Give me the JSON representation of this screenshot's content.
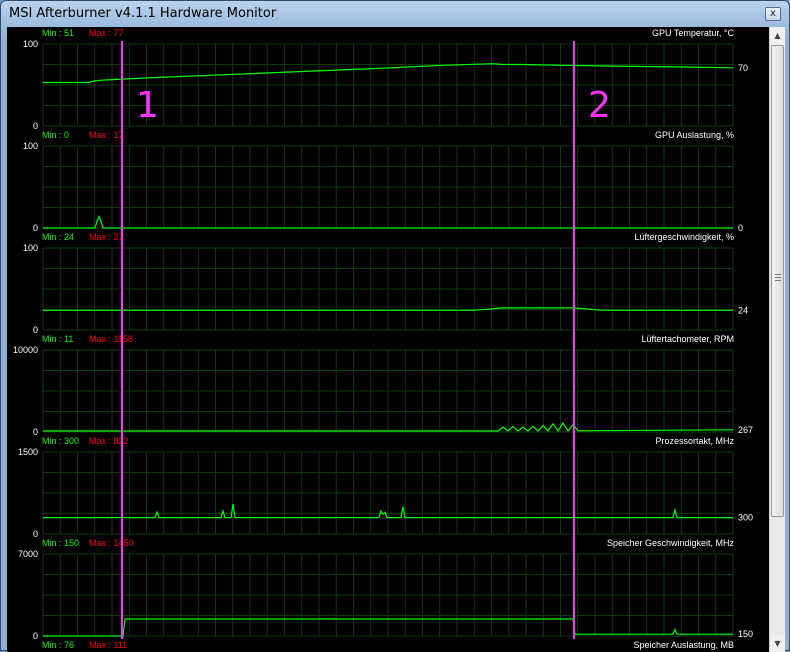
{
  "window": {
    "title": "MSI Afterburner v4.1.1 Hardware Monitor",
    "close_label": "x"
  },
  "scrollbar": {
    "up_arrow": "▲",
    "down_arrow": "▼"
  },
  "colors": {
    "graph_line": "#00ff00",
    "grid": "#0c3a0c",
    "marker": "#ff30ff",
    "min_text": "#00ff00",
    "max_text": "#ff0000"
  },
  "markers": [
    {
      "label": "1"
    },
    {
      "label": "2"
    }
  ],
  "graphs": [
    {
      "id": "gpu-temp",
      "title": "GPU Temperatur, °C",
      "min_label": "Min : 51",
      "max_label": "Max : 77",
      "y_top": "100",
      "y_bottom": "0",
      "current": "70",
      "ymax": 100,
      "series": [
        [
          0,
          53
        ],
        [
          45,
          53
        ],
        [
          52,
          55
        ],
        [
          60,
          56
        ],
        [
          110,
          59
        ],
        [
          170,
          62
        ],
        [
          250,
          66
        ],
        [
          330,
          70
        ],
        [
          400,
          74
        ],
        [
          450,
          76
        ],
        [
          460,
          75
        ],
        [
          480,
          75
        ],
        [
          520,
          74
        ],
        [
          570,
          73
        ],
        [
          640,
          72
        ],
        [
          690,
          71
        ]
      ]
    },
    {
      "id": "gpu-load",
      "title": "GPU Auslastung, %",
      "min_label": "Min : 0",
      "max_label": "Max : 17",
      "y_top": "100",
      "y_bottom": "0",
      "current": "0",
      "ymax": 100,
      "series": [
        [
          0,
          0
        ],
        [
          52,
          0
        ],
        [
          54,
          8
        ],
        [
          56,
          14
        ],
        [
          58,
          8
        ],
        [
          60,
          0
        ],
        [
          530,
          0
        ],
        [
          531,
          4
        ],
        [
          532,
          0
        ],
        [
          690,
          0
        ]
      ]
    },
    {
      "id": "fan-speed",
      "title": "Lüftergeschwindigkeit, %",
      "min_label": "Min : 24",
      "max_label": "Max : 27",
      "y_top": "100",
      "y_bottom": "0",
      "current": "24",
      "ymax": 100,
      "series": [
        [
          0,
          24
        ],
        [
          430,
          24
        ],
        [
          460,
          27
        ],
        [
          530,
          27
        ],
        [
          560,
          24
        ],
        [
          690,
          24
        ]
      ]
    },
    {
      "id": "fan-tach",
      "title": "Lüftertachometer, RPM",
      "min_label": "Min : 11",
      "max_label": "Max : 1158",
      "y_top": "10000",
      "y_bottom": "0",
      "current": "267",
      "ymax": 10000,
      "series": [
        [
          0,
          120
        ],
        [
          455,
          120
        ],
        [
          460,
          600
        ],
        [
          465,
          120
        ],
        [
          470,
          700
        ],
        [
          475,
          120
        ],
        [
          480,
          600
        ],
        [
          485,
          120
        ],
        [
          490,
          700
        ],
        [
          495,
          120
        ],
        [
          500,
          800
        ],
        [
          505,
          120
        ],
        [
          510,
          1000
        ],
        [
          515,
          120
        ],
        [
          520,
          1100
        ],
        [
          525,
          120
        ],
        [
          530,
          900
        ],
        [
          535,
          150
        ],
        [
          690,
          267
        ]
      ]
    },
    {
      "id": "cpu-clock",
      "title": "Prozessortakt, MHz",
      "min_label": "Min : 300",
      "max_label": "Max : 822",
      "y_top": "1500",
      "y_bottom": "0",
      "current": "300",
      "ymax": 1500,
      "series": [
        [
          0,
          300
        ],
        [
          112,
          300
        ],
        [
          114,
          400
        ],
        [
          116,
          300
        ],
        [
          178,
          300
        ],
        [
          180,
          420
        ],
        [
          182,
          300
        ],
        [
          188,
          300
        ],
        [
          190,
          550
        ],
        [
          192,
          300
        ],
        [
          336,
          300
        ],
        [
          338,
          420
        ],
        [
          340,
          360
        ],
        [
          342,
          400
        ],
        [
          344,
          300
        ],
        [
          358,
          300
        ],
        [
          360,
          500
        ],
        [
          362,
          300
        ],
        [
          630,
          300
        ],
        [
          632,
          440
        ],
        [
          634,
          300
        ],
        [
          690,
          300
        ]
      ]
    },
    {
      "id": "mem-clock",
      "title": "Speicher Geschwindigkeit, MHz",
      "min_label": "Min : 150",
      "max_label": "Max : 1450",
      "y_top": "7000",
      "y_bottom": "0",
      "current": "150",
      "ymax": 7000,
      "series": [
        [
          0,
          0
        ],
        [
          80,
          0
        ],
        [
          82,
          1450
        ],
        [
          530,
          1450
        ],
        [
          532,
          150
        ],
        [
          630,
          150
        ],
        [
          632,
          550
        ],
        [
          634,
          150
        ],
        [
          690,
          150
        ]
      ]
    }
  ],
  "footer_graph": {
    "title": "Speicher Auslastung, MB",
    "min_label": "Min : 76",
    "max_label": "Max : 111"
  }
}
